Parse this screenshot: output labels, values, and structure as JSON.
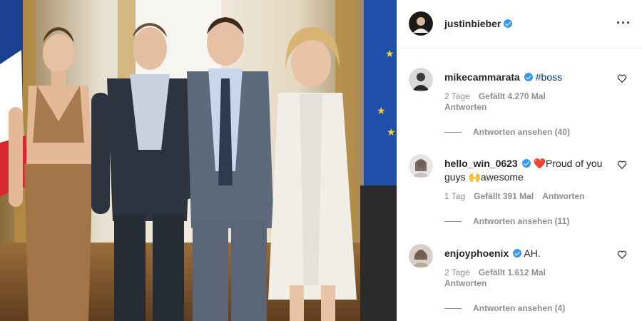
{
  "post": {
    "author": "justinbieber",
    "author_verified": true,
    "more_icon": "more-horizontal-icon"
  },
  "comments": [
    {
      "username": "mikecammarata",
      "verified": true,
      "text": "#boss",
      "age": "2 Tage",
      "likes": "Gefällt 4.270 Mal",
      "reply_label": "Antworten",
      "view_replies": "Antworten ansehen (40)"
    },
    {
      "username": "hello_win_0623",
      "verified": true,
      "emoji_1": "❤️",
      "text_1": "Proud of you guys",
      "emoji_2": "🙌",
      "text_2": "awesome",
      "age": "1 Tag",
      "likes": "Gefällt 391 Mal",
      "reply_label": "Antworten",
      "view_replies": "Antworten ansehen (11)"
    },
    {
      "username": "enjoyphoenix",
      "verified": true,
      "text": "AH.",
      "age": "2 Tage",
      "likes": "Gefällt 1.612 Mal",
      "reply_label": "Antworten",
      "view_replies": "Antworten ansehen (4)"
    }
  ],
  "colors": {
    "verified_blue": "#3897f0",
    "meta_gray": "#8e8e8e",
    "hashtag": "#00376b"
  }
}
